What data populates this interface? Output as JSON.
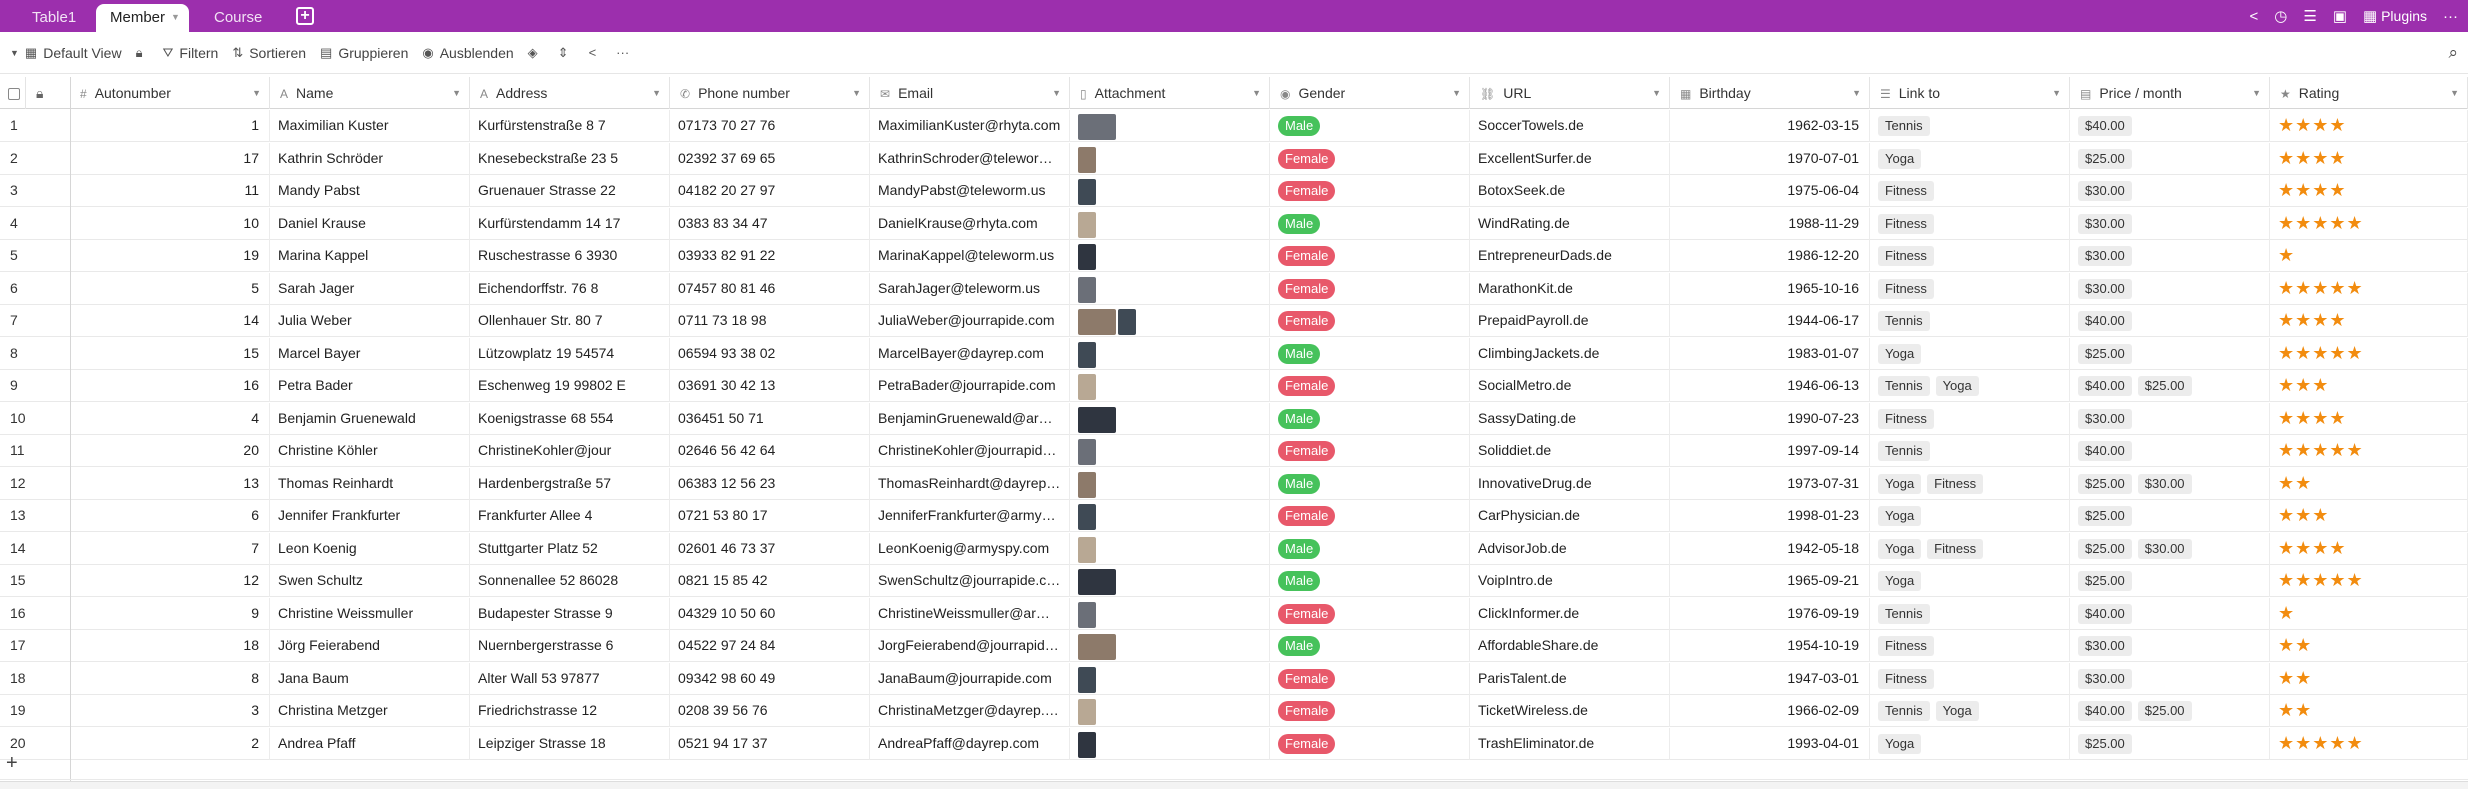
{
  "tabs": [
    {
      "label": "Table1",
      "active": false
    },
    {
      "label": "Member",
      "active": true
    },
    {
      "label": "Course",
      "active": false
    }
  ],
  "topbar_right": {
    "plugins_label": "Plugins"
  },
  "toolbar": {
    "view_label": "Default View",
    "filter_label": "Filtern",
    "sort_label": "Sortieren",
    "group_label": "Gruppieren",
    "hide_label": "Ausblenden"
  },
  "columns": [
    "Autonumber",
    "Name",
    "Address",
    "Phone number",
    "Email",
    "Attachment",
    "Gender",
    "URL",
    "Birthday",
    "Link to",
    "Price / month",
    "Rating"
  ],
  "colors": {
    "accent": "#9c2fad",
    "male": "#46c25b",
    "female": "#e8586a",
    "star": "#f28c0f"
  },
  "rows": [
    {
      "idx": "1",
      "auto": "1",
      "name": "Maximilian Kuster",
      "address": "Kurfürstenstraße 8 7",
      "phone": "07173 70 27 76",
      "email": "MaximilianKuster@rhyta.com",
      "gender": "Male",
      "url": "SoccerTowels.de",
      "birthday": "1962-03-15",
      "links": [
        "Tennis"
      ],
      "prices": [
        "$40.00"
      ],
      "rating": 4,
      "thumbs": [
        1
      ]
    },
    {
      "idx": "2",
      "auto": "17",
      "name": "Kathrin Schröder",
      "address": "Knesebeckstraße 23 5",
      "phone": "02392 37 69 65",
      "email": "KathrinSchroder@teleworm.us",
      "gender": "Female",
      "url": "ExcellentSurfer.de",
      "birthday": "1970-07-01",
      "links": [
        "Yoga"
      ],
      "prices": [
        "$25.00"
      ],
      "rating": 4,
      "thumbs": [
        0
      ]
    },
    {
      "idx": "3",
      "auto": "11",
      "name": "Mandy Pabst",
      "address": "Gruenauer Strasse 22",
      "phone": "04182 20 27 97",
      "email": "MandyPabst@teleworm.us",
      "gender": "Female",
      "url": "BotoxSeek.de",
      "birthday": "1975-06-04",
      "links": [
        "Fitness"
      ],
      "prices": [
        "$30.00"
      ],
      "rating": 4,
      "thumbs": [
        0
      ]
    },
    {
      "idx": "4",
      "auto": "10",
      "name": "Daniel Krause",
      "address": "Kurfürstendamm 14 17",
      "phone": "0383 83 34 47",
      "email": "DanielKrause@rhyta.com",
      "gender": "Male",
      "url": "WindRating.de",
      "birthday": "1988-11-29",
      "links": [
        "Fitness"
      ],
      "prices": [
        "$30.00"
      ],
      "rating": 5,
      "thumbs": [
        0
      ]
    },
    {
      "idx": "5",
      "auto": "19",
      "name": "Marina Kappel",
      "address": "Ruschestrasse 6 3930",
      "phone": "03933 82 91 22",
      "email": "MarinaKappel@teleworm.us",
      "gender": "Female",
      "url": "EntrepreneurDads.de",
      "birthday": "1986-12-20",
      "links": [
        "Fitness"
      ],
      "prices": [
        "$30.00"
      ],
      "rating": 1,
      "thumbs": [
        0
      ]
    },
    {
      "idx": "6",
      "auto": "5",
      "name": "Sarah Jager",
      "address": "Eichendorffstr. 76 8",
      "phone": "07457 80 81 46",
      "email": "SarahJager@teleworm.us",
      "gender": "Female",
      "url": "MarathonKit.de",
      "birthday": "1965-10-16",
      "links": [
        "Fitness"
      ],
      "prices": [
        "$30.00"
      ],
      "rating": 5,
      "thumbs": [
        0
      ]
    },
    {
      "idx": "7",
      "auto": "14",
      "name": "Julia Weber",
      "address": "Ollenhauer Str. 80 7",
      "phone": "0711 73 18 98",
      "email": "JuliaWeber@jourrapide.com",
      "gender": "Female",
      "url": "PrepaidPayroll.de",
      "birthday": "1944-06-17",
      "links": [
        "Tennis"
      ],
      "prices": [
        "$40.00"
      ],
      "rating": 4,
      "thumbs": [
        1,
        0
      ]
    },
    {
      "idx": "8",
      "auto": "15",
      "name": "Marcel Bayer",
      "address": "Lützowplatz 19 54574",
      "phone": "06594 93 38 02",
      "email": "MarcelBayer@dayrep.com",
      "gender": "Male",
      "url": "ClimbingJackets.de",
      "birthday": "1983-01-07",
      "links": [
        "Yoga"
      ],
      "prices": [
        "$25.00"
      ],
      "rating": 5,
      "thumbs": [
        0
      ]
    },
    {
      "idx": "9",
      "auto": "16",
      "name": "Petra Bader",
      "address": "Eschenweg 19 99802 E",
      "phone": "03691 30 42 13",
      "email": "PetraBader@jourrapide.com",
      "gender": "Female",
      "url": "SocialMetro.de",
      "birthday": "1946-06-13",
      "links": [
        "Tennis",
        "Yoga"
      ],
      "prices": [
        "$40.00",
        "$25.00"
      ],
      "rating": 3,
      "thumbs": [
        0
      ]
    },
    {
      "idx": "10",
      "auto": "4",
      "name": "Benjamin Gruenewald",
      "address": "Koenigstrasse 68 554",
      "phone": "036451 50 71",
      "email": "BenjaminGruenewald@armyspy.com",
      "gender": "Male",
      "url": "SassyDating.de",
      "birthday": "1990-07-23",
      "links": [
        "Fitness"
      ],
      "prices": [
        "$30.00"
      ],
      "rating": 4,
      "thumbs": [
        1
      ]
    },
    {
      "idx": "11",
      "auto": "20",
      "name": "Christine Köhler",
      "address": "ChristineKohler@jour",
      "phone": "02646 56 42 64",
      "email": "ChristineKohler@jourrapide.com",
      "gender": "Female",
      "url": "Soliddiet.de",
      "birthday": "1997-09-14",
      "links": [
        "Tennis"
      ],
      "prices": [
        "$40.00"
      ],
      "rating": 5,
      "thumbs": [
        0
      ]
    },
    {
      "idx": "12",
      "auto": "13",
      "name": "Thomas Reinhardt",
      "address": "Hardenbergstraße 57",
      "phone": "06383 12 56 23",
      "email": "ThomasReinhardt@dayrep.com",
      "gender": "Male",
      "url": "InnovativeDrug.de",
      "birthday": "1973-07-31",
      "links": [
        "Yoga",
        "Fitness"
      ],
      "prices": [
        "$25.00",
        "$30.00"
      ],
      "rating": 2,
      "thumbs": [
        0
      ]
    },
    {
      "idx": "13",
      "auto": "6",
      "name": "Jennifer Frankfurter",
      "address": "Frankfurter Allee 4",
      "phone": "0721 53 80 17",
      "email": "JenniferFrankfurter@armyspy.com",
      "gender": "Female",
      "url": "CarPhysician.de",
      "birthday": "1998-01-23",
      "links": [
        "Yoga"
      ],
      "prices": [
        "$25.00"
      ],
      "rating": 3,
      "thumbs": [
        0
      ]
    },
    {
      "idx": "14",
      "auto": "7",
      "name": "Leon Koenig",
      "address": "Stuttgarter Platz 52",
      "phone": "02601 46 73 37",
      "email": "LeonKoenig@armyspy.com",
      "gender": "Male",
      "url": "AdvisorJob.de",
      "birthday": "1942-05-18",
      "links": [
        "Yoga",
        "Fitness"
      ],
      "prices": [
        "$25.00",
        "$30.00"
      ],
      "rating": 4,
      "thumbs": [
        0
      ]
    },
    {
      "idx": "15",
      "auto": "12",
      "name": "Swen Schultz",
      "address": "Sonnenallee 52 86028",
      "phone": "0821 15 85 42",
      "email": "SwenSchultz@jourrapide.com",
      "gender": "Male",
      "url": "VoipIntro.de",
      "birthday": "1965-09-21",
      "links": [
        "Yoga"
      ],
      "prices": [
        "$25.00"
      ],
      "rating": 5,
      "thumbs": [
        1
      ]
    },
    {
      "idx": "16",
      "auto": "9",
      "name": "Christine Weissmuller",
      "address": "Budapester Strasse 9",
      "phone": "04329 10 50 60",
      "email": "ChristineWeissmuller@armyspy.com",
      "gender": "Female",
      "url": "ClickInformer.de",
      "birthday": "1976-09-19",
      "links": [
        "Tennis"
      ],
      "prices": [
        "$40.00"
      ],
      "rating": 1,
      "thumbs": [
        0
      ]
    },
    {
      "idx": "17",
      "auto": "18",
      "name": "Jörg Feierabend",
      "address": "Nuernbergerstrasse 6",
      "phone": "04522 97 24 84",
      "email": "JorgFeierabend@jourrapide.com",
      "gender": "Male",
      "url": "AffordableShare.de",
      "birthday": "1954-10-19",
      "links": [
        "Fitness"
      ],
      "prices": [
        "$30.00"
      ],
      "rating": 2,
      "thumbs": [
        1
      ]
    },
    {
      "idx": "18",
      "auto": "8",
      "name": "Jana Baum",
      "address": "Alter Wall 53 97877",
      "phone": "09342 98 60 49",
      "email": "JanaBaum@jourrapide.com",
      "gender": "Female",
      "url": "ParisTalent.de",
      "birthday": "1947-03-01",
      "links": [
        "Fitness"
      ],
      "prices": [
        "$30.00"
      ],
      "rating": 2,
      "thumbs": [
        0
      ]
    },
    {
      "idx": "19",
      "auto": "3",
      "name": "Christina Metzger",
      "address": "Friedrichstrasse 12",
      "phone": "0208 39 56 76",
      "email": "ChristinaMetzger@dayrep.com",
      "gender": "Female",
      "url": "TicketWireless.de",
      "birthday": "1966-02-09",
      "links": [
        "Tennis",
        "Yoga"
      ],
      "prices": [
        "$40.00",
        "$25.00"
      ],
      "rating": 2,
      "thumbs": [
        0
      ]
    },
    {
      "idx": "20",
      "auto": "2",
      "name": "Andrea Pfaff",
      "address": "Leipziger Strasse 18",
      "phone": "0521 94 17 37",
      "email": "AndreaPfaff@dayrep.com",
      "gender": "Female",
      "url": "TrashEliminator.de",
      "birthday": "1993-04-01",
      "links": [
        "Yoga"
      ],
      "prices": [
        "$25.00"
      ],
      "rating": 5,
      "thumbs": [
        0
      ]
    }
  ]
}
